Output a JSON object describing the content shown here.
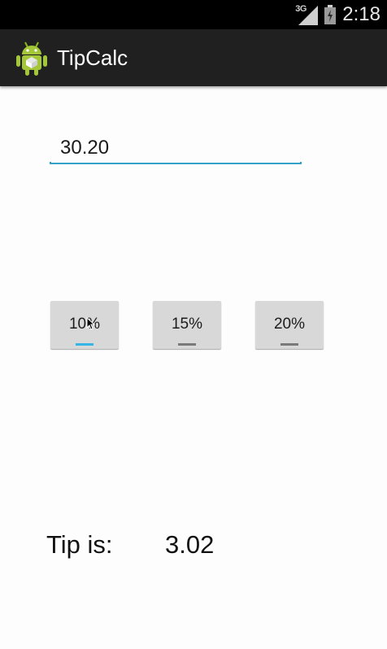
{
  "status_bar": {
    "network_label": "3G",
    "time": "2:18",
    "icons": [
      "signal-icon",
      "battery-icon"
    ]
  },
  "action_bar": {
    "app_icon": "android-icon",
    "title": "TipCalc"
  },
  "bill": {
    "value": "30.20"
  },
  "tip_buttons": [
    {
      "label": "10%",
      "active": true
    },
    {
      "label": "15%",
      "active": false
    },
    {
      "label": "20%",
      "active": false
    }
  ],
  "result": {
    "label": "Tip is:",
    "value": "3.02"
  },
  "colors": {
    "accent": "#33b5e5",
    "action_bar": "#202020",
    "status_bar": "#000000"
  }
}
